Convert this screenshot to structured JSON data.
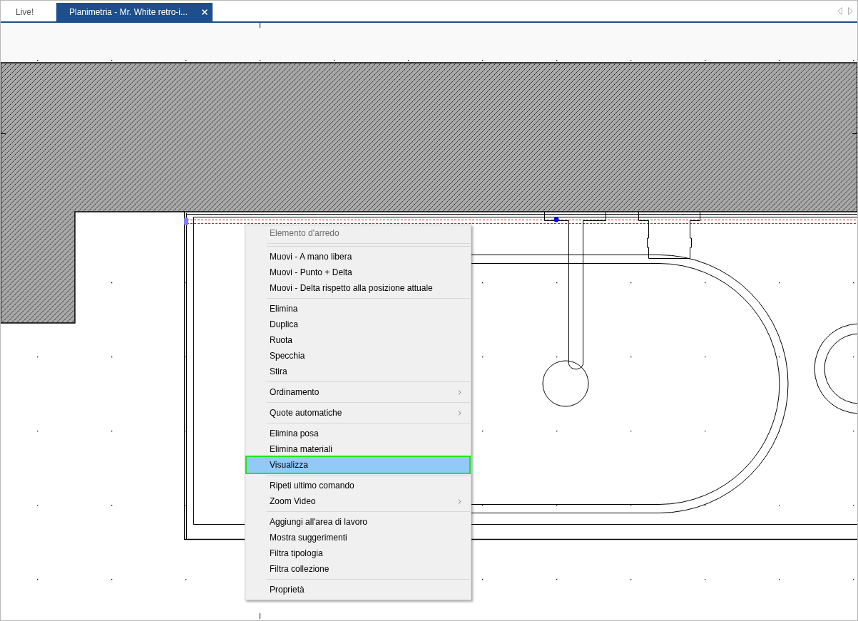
{
  "tabs": [
    {
      "label": "Live!",
      "selected": false,
      "closable": false
    },
    {
      "label": "Planimetria - Mr. White retro-i...",
      "selected": true,
      "closable": true
    }
  ],
  "context_menu": {
    "header": {
      "label": "Elemento d'arredo",
      "disabled": true
    },
    "groups": [
      {
        "items": [
          {
            "label": "Muovi - A mano libera",
            "submenu": false,
            "selected": false
          },
          {
            "label": "Muovi - Punto + Delta",
            "submenu": false,
            "selected": false
          },
          {
            "label": "Muovi - Delta rispetto alla posizione attuale",
            "submenu": false,
            "selected": false
          }
        ]
      },
      {
        "items": [
          {
            "label": "Elimina",
            "submenu": false,
            "selected": false
          },
          {
            "label": "Duplica",
            "submenu": false,
            "selected": false
          },
          {
            "label": "Ruota",
            "submenu": false,
            "selected": false
          },
          {
            "label": "Specchia",
            "submenu": false,
            "selected": false
          },
          {
            "label": "Stira",
            "submenu": false,
            "selected": false
          }
        ]
      },
      {
        "items": [
          {
            "label": "Ordinamento",
            "submenu": true,
            "selected": false
          }
        ]
      },
      {
        "items": [
          {
            "label": "Quote automatiche",
            "submenu": true,
            "selected": false
          }
        ]
      },
      {
        "items": [
          {
            "label": "Elimina posa",
            "submenu": false,
            "selected": false
          },
          {
            "label": "Elimina materiali",
            "submenu": false,
            "selected": false
          },
          {
            "label": "Visualizza",
            "submenu": false,
            "selected": true
          }
        ]
      },
      {
        "items": [
          {
            "label": "Ripeti ultimo comando",
            "submenu": false,
            "selected": false
          },
          {
            "label": "Zoom Video",
            "submenu": true,
            "selected": false
          }
        ]
      },
      {
        "items": [
          {
            "label": "Aggiungi all'area di lavoro",
            "submenu": false,
            "selected": false
          },
          {
            "label": "Mostra suggerimenti",
            "submenu": false,
            "selected": false
          },
          {
            "label": "Filtra tipologia",
            "submenu": false,
            "selected": false
          },
          {
            "label": "Filtra collezione",
            "submenu": false,
            "selected": false
          }
        ]
      },
      {
        "items": [
          {
            "label": "Proprietà",
            "submenu": false,
            "selected": false
          }
        ]
      }
    ]
  }
}
